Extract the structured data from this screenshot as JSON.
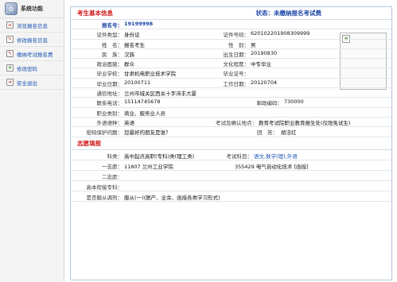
{
  "sidebar": {
    "title": "系统功能",
    "items": [
      {
        "label": "浏览报名信息",
        "icon": "document-icon"
      },
      {
        "label": "修改报名信息",
        "icon": "edit-icon"
      },
      {
        "label": "缴纳考试报名费",
        "icon": "payment-icon"
      },
      {
        "label": "修改密码",
        "icon": "key-icon"
      },
      {
        "label": "安全退出",
        "icon": "logout-icon"
      }
    ]
  },
  "basic": {
    "title": "考生基本信息",
    "status": "状态：未缴纳报名考试费",
    "reg_label": "报名号：",
    "reg_value": "19199998",
    "id_type_label": "证件类型：",
    "id_type_value": "身份证",
    "id_no_label": "证件号码：",
    "id_no_value": "620102201908309999",
    "name_label": "姓　名：",
    "name_value": "报名考生",
    "gender_label": "性　别：",
    "gender_value": "男",
    "ethnic_label": "民　族：",
    "ethnic_value": "汉族",
    "birth_label": "出生日期：",
    "birth_value": "20190830",
    "politic_label": "政治面貌：",
    "politic_value": "群众",
    "edu_label": "文化程度：",
    "edu_value": "中专毕业",
    "school_label": "毕业学校：",
    "school_value": "甘肃机电职业技术学院",
    "cert_label": "毕业证号：",
    "cert_value": "",
    "grad_date_label": "毕业日期：",
    "grad_date_value": "20100711",
    "work_date_label": "工作日期：",
    "work_date_value": "20120704",
    "address_label": "通信地址：",
    "address_value": "兰州市城关区西关十字沛丰大厦",
    "phone_label": "联系电话：",
    "phone_value": "15114745678",
    "postcode_label": "邮政编码：",
    "postcode_value": "730000",
    "occupation_label": "职业类别：",
    "occupation_value": "商业、服务业人员",
    "language_label": "外语语种：",
    "language_value": "英语",
    "exam_site_label": "考试及确认地点：",
    "exam_site_value": "教育考试院职业教育报生处(仅限免试生)",
    "question_label": "密码保护问题：",
    "question_value": "您最好的朋友是谁？",
    "answer_label": "回　答：",
    "answer_value": "胡法红"
  },
  "apply": {
    "title": "志愿填报",
    "category_label": "科类：",
    "category_value": "高中起点高职(专科)类(理工类)",
    "subjects_label": "考试科目：",
    "subjects_value": "语文,数学(理),外语",
    "first_label": "一志愿：",
    "first_school": "11807 兰州工业学院",
    "first_major": "355429 电气自动化技术 [函授]",
    "second_label": "二志愿：",
    "second_value": "",
    "undergrad_label": "高本衔接专科：",
    "undergrad_value": "",
    "adjust_label": "是否服从调剂：",
    "adjust_value": "服从(一)(脱产、业余、函授各类学习形式)"
  }
}
